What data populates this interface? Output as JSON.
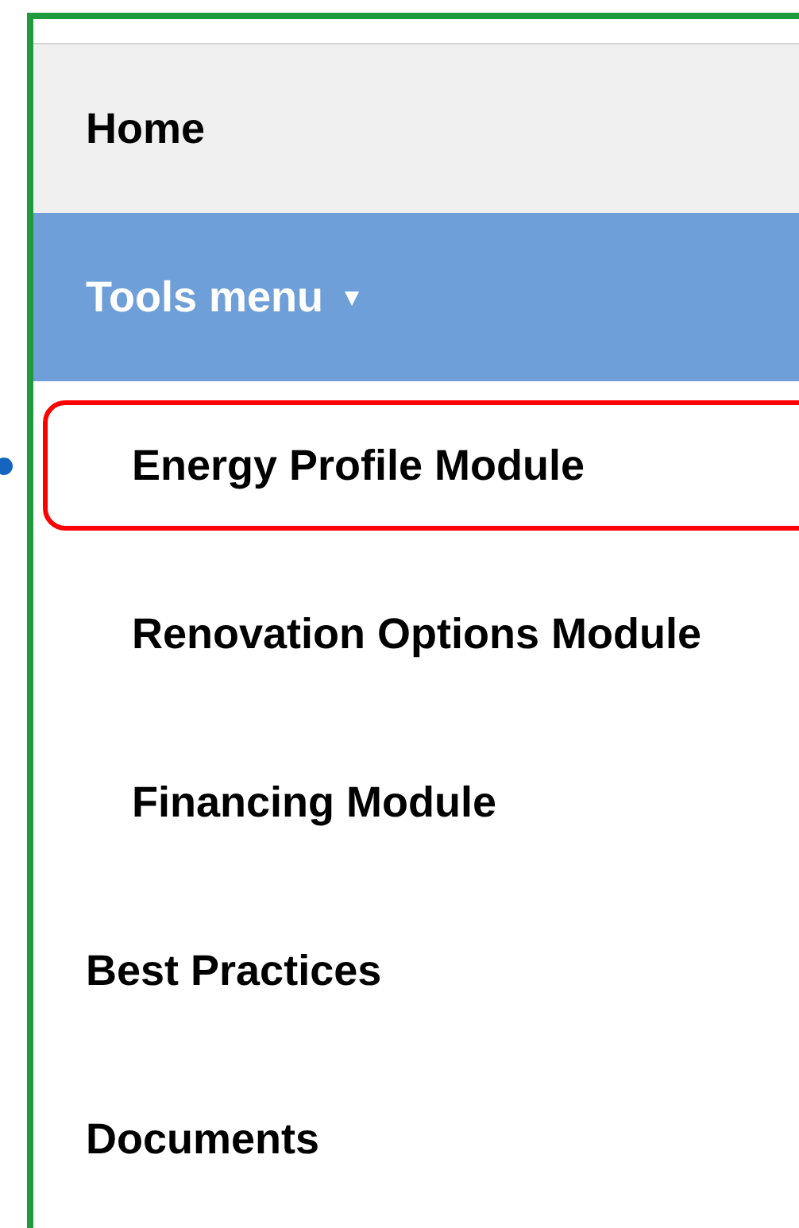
{
  "nav": {
    "items": [
      {
        "label": "Home",
        "kind": "link",
        "hovered": true,
        "selected": false
      },
      {
        "label": "Tools menu",
        "kind": "menu",
        "caret": "▾",
        "selected": true,
        "expanded": true,
        "children": [
          {
            "label": "Energy Profile Module",
            "highlighted": true
          },
          {
            "label": "Renovation Options Module",
            "highlighted": false
          },
          {
            "label": "Financing Module",
            "highlighted": false
          }
        ]
      },
      {
        "label": "Best Practices",
        "kind": "link",
        "hovered": false,
        "selected": false
      },
      {
        "label": "Documents",
        "kind": "link",
        "hovered": false,
        "selected": false
      }
    ]
  }
}
